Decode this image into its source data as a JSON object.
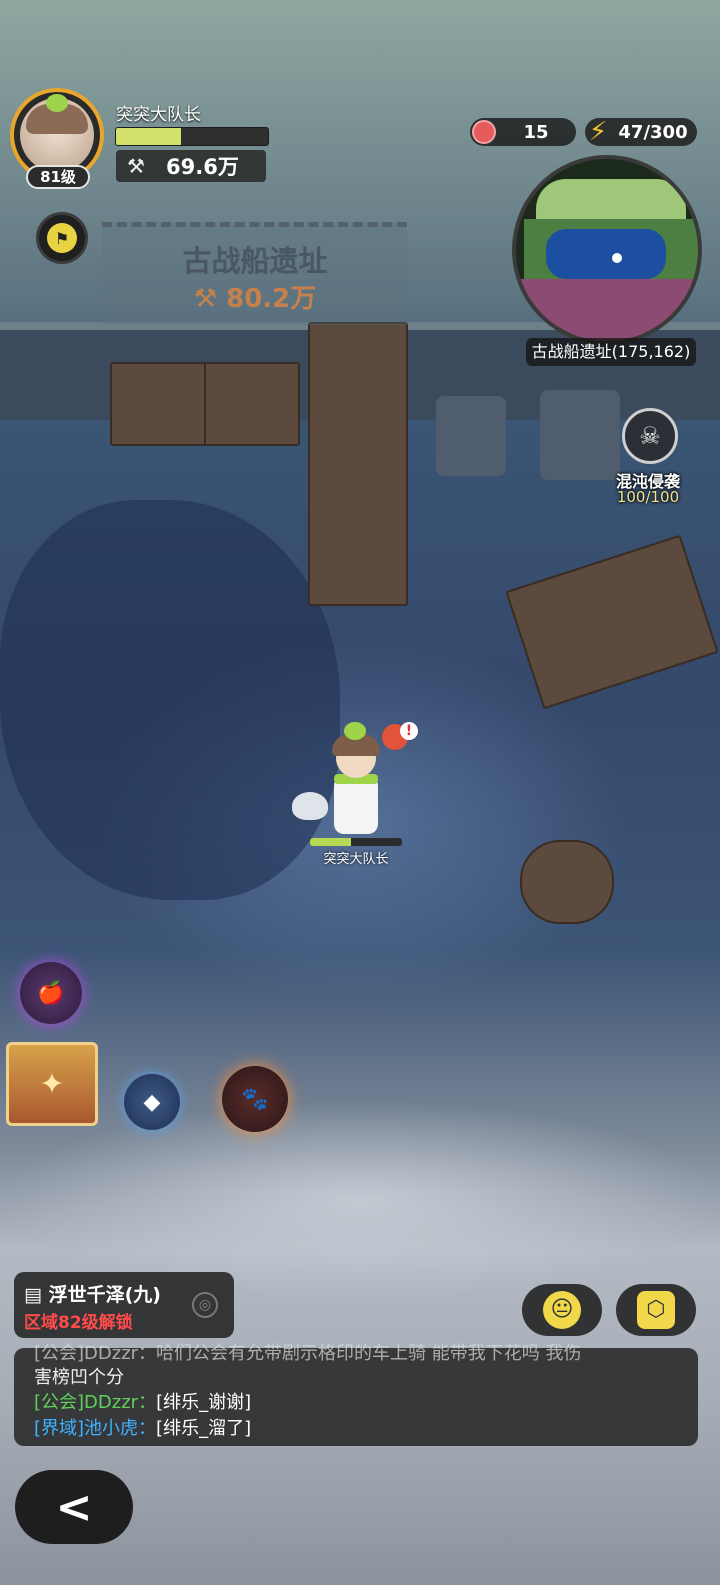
{
  "player": {
    "name": "突突大队长",
    "level": "81级",
    "power": "69.6万",
    "xp_fraction": 0.43
  },
  "area": {
    "title": "古战船遗址",
    "recommended_power": "80.2万"
  },
  "resources": {
    "apples": "15",
    "energy": "47/300"
  },
  "minimap": {
    "location_label": "古战船遗址(175,162)"
  },
  "event": {
    "name": "混沌侵袭",
    "count": "100/100"
  },
  "character": {
    "name": "突突大队长",
    "hp_fraction": 0.45
  },
  "region": {
    "name": "浮世千泽(九)",
    "unlock_text": "区域82级解锁"
  },
  "chat": {
    "partial_line": "[公会]DDzzr：哈们公会有允带剧示格印的车上骑 能带我下花吗 我伤",
    "partial_line_cont": "害榜凹个分",
    "lines": [
      {
        "tag": "[公会]",
        "sender": "DDzzr：",
        "text": "[绯乐_谢谢]"
      },
      {
        "tag": "[界域]",
        "sender": "池小虎：",
        "text": "[绯乐_溜了]"
      }
    ]
  },
  "icons": {
    "power": "crossed-swords-icon",
    "apple": "apple-icon",
    "energy": "lightning-bolt-icon",
    "back": "chevron-left-icon",
    "emoji": "emoji-face-icon",
    "cube": "cube-icon"
  },
  "colors": {
    "xp_fill": "#d3e06a",
    "lock_text": "#ff4b4b",
    "guild_tag": "#5fd15b",
    "world_tag": "#3fb3ff",
    "energy": "#f5c521"
  }
}
